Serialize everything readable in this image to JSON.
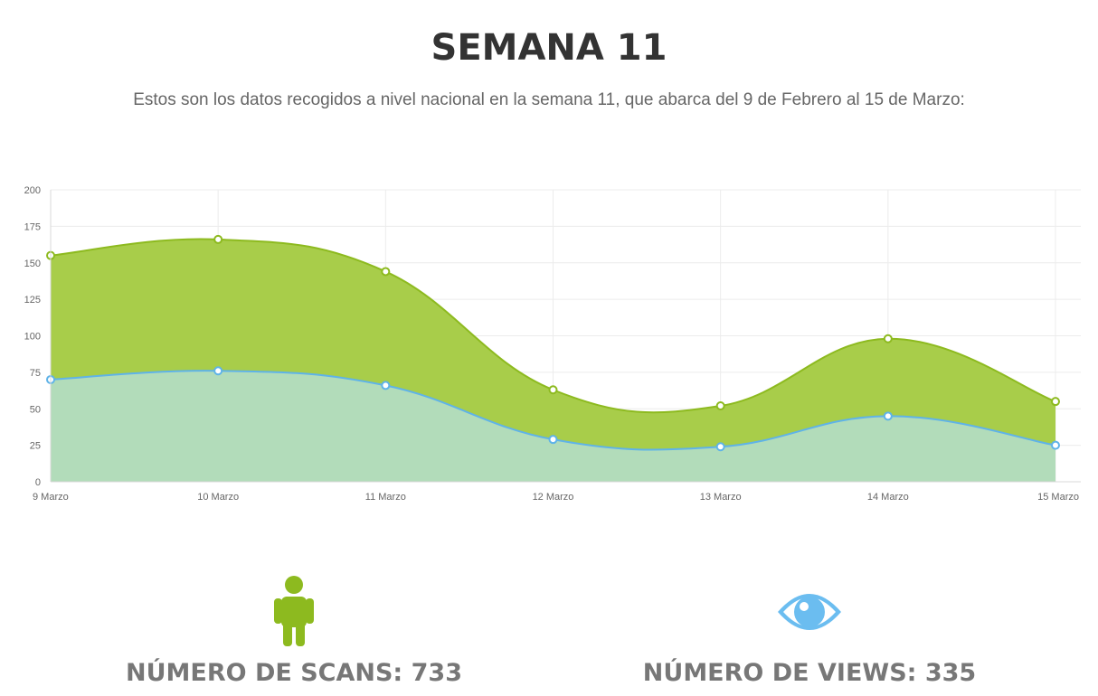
{
  "header": {
    "title": "SEMANA 11",
    "subtitle": "Estos son los datos recogidos a nivel nacional en la semana 11, que abarca del 9 de Febrero al 15 de Marzo:"
  },
  "chart_data": {
    "type": "area",
    "categories": [
      "9 Marzo",
      "10 Marzo",
      "11 Marzo",
      "12 Marzo",
      "13 Marzo",
      "14 Marzo",
      "15 Marzo"
    ],
    "series": [
      {
        "values": [
          155,
          166,
          144,
          63,
          52,
          98,
          55
        ],
        "color": "#8dba1f",
        "fill": "#a8cd4a"
      },
      {
        "values": [
          70,
          76,
          66,
          29,
          24,
          45,
          25
        ],
        "color": "#5fb3e8",
        "fill": "#b2dcba"
      }
    ],
    "ylim": [
      0,
      200
    ],
    "yticks": [
      0,
      25,
      50,
      75,
      100,
      125,
      150,
      175,
      200
    ],
    "grid": true,
    "title": "",
    "xlabel": "",
    "ylabel": ""
  },
  "stats": {
    "scans": {
      "label": "NÚMERO DE SCANS: 733",
      "icon": "person-icon",
      "color": "#8dba1f"
    },
    "views": {
      "label": "NÚMERO DE VIEWS: 335",
      "icon": "eye-icon",
      "color": "#6bbdf0"
    }
  }
}
